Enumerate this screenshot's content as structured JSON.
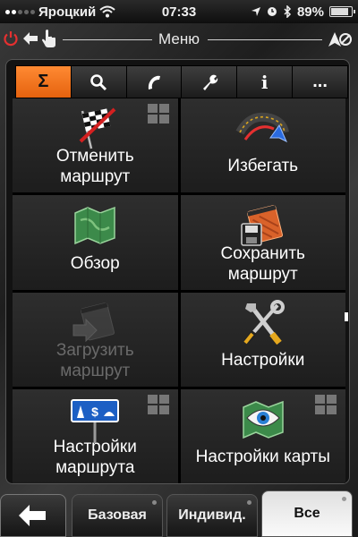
{
  "status": {
    "carrier": "Яроцкий",
    "time": "07:33",
    "battery_text": "89%",
    "battery_level": 0.89,
    "signal_bars_on": 2
  },
  "header": {
    "title": "Меню"
  },
  "tabs": [
    {
      "label": "Σ",
      "active": true,
      "icon": "sigma-icon"
    },
    {
      "label": "",
      "active": false,
      "icon": "search-icon"
    },
    {
      "label": "",
      "active": false,
      "icon": "phone-icon"
    },
    {
      "label": "",
      "active": false,
      "icon": "wrench-icon"
    },
    {
      "label": "i",
      "active": false,
      "icon": "info-icon"
    },
    {
      "label": "...",
      "active": false,
      "icon": "more-icon"
    }
  ],
  "menu": {
    "cancel_route": "Отменить маршрут",
    "avoid": "Избегать",
    "overview": "Обзор",
    "save_route": "Сохранить маршрут",
    "load_route": "Загрузить маршрут",
    "settings": "Настройки",
    "route_settings": "Настройки маршрута",
    "map_settings": "Настройки карты",
    "sign_text": "$"
  },
  "bottom": {
    "basic": "Базовая",
    "custom": "Индивид.",
    "all": "Все"
  },
  "colors": {
    "accent": "#f27322",
    "power_red": "#e53030"
  }
}
